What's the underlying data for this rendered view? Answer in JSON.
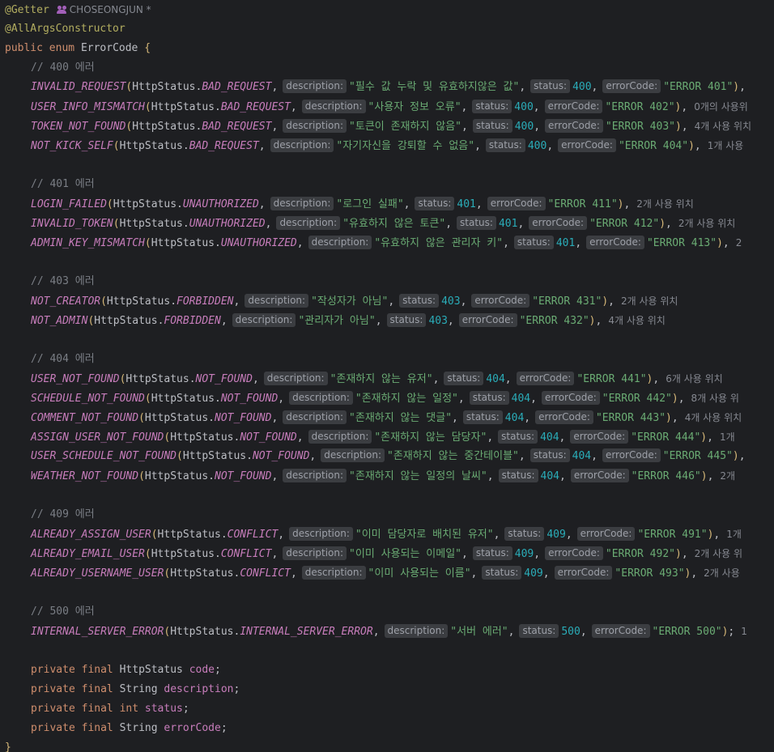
{
  "header": {
    "annotation_getter": "@Getter",
    "author": "CHOSEONGJUN *",
    "annotation_constructor": "@AllArgsConstructor",
    "kw_public": "public",
    "kw_enum": "enum",
    "class_name": "ErrorCode",
    "open_brace": "{"
  },
  "hints": {
    "description": "description:",
    "status": "status:",
    "errorCode": "errorCode:"
  },
  "groups": [
    {
      "comment": "// 400 에러",
      "entries": [
        {
          "name": "INVALID_REQUEST",
          "status_enum": "BAD_REQUEST",
          "description": "\"필수 값 누락 및 유효하지않은 값\"",
          "status": "400",
          "code": "\"ERROR 401\"",
          "usage": ""
        },
        {
          "name": "USER_INFO_MISMATCH",
          "status_enum": "BAD_REQUEST",
          "description": "\"사용자 정보 오류\"",
          "status": "400",
          "code": "\"ERROR 402\"",
          "usage": "0개의 사용위"
        },
        {
          "name": "TOKEN_NOT_FOUND",
          "status_enum": "BAD_REQUEST",
          "description": "\"토큰이 존재하지 않음\"",
          "status": "400",
          "code": "\"ERROR 403\"",
          "usage": "4개 사용 위치"
        },
        {
          "name": "NOT_KICK_SELF",
          "status_enum": "BAD_REQUEST",
          "description": "\"자기자신을 강퇴할 수 없음\"",
          "status": "400",
          "code": "\"ERROR 404\"",
          "usage": "1개 사용"
        }
      ]
    },
    {
      "comment": "// 401 에러",
      "entries": [
        {
          "name": "LOGIN_FAILED",
          "status_enum": "UNAUTHORIZED",
          "description": "\"로그인 실패\"",
          "status": "401",
          "code": "\"ERROR 411\"",
          "usage": "2개 사용 위치"
        },
        {
          "name": "INVALID_TOKEN",
          "status_enum": "UNAUTHORIZED",
          "description": "\"유효하지 않은 토큰\"",
          "status": "401",
          "code": "\"ERROR 412\"",
          "usage": "2개 사용 위치"
        },
        {
          "name": "ADMIN_KEY_MISMATCH",
          "status_enum": "UNAUTHORIZED",
          "description": "\"유효하지 않은 관리자 키\"",
          "status": "401",
          "code": "\"ERROR 413\"",
          "usage": "2"
        }
      ]
    },
    {
      "comment": "// 403 에러",
      "entries": [
        {
          "name": "NOT_CREATOR",
          "status_enum": "FORBIDDEN",
          "description": "\"작성자가 아님\"",
          "status": "403",
          "code": "\"ERROR 431\"",
          "usage": "2개 사용 위치"
        },
        {
          "name": "NOT_ADMIN",
          "status_enum": "FORBIDDEN",
          "description": "\"관리자가 아님\"",
          "status": "403",
          "code": "\"ERROR 432\"",
          "usage": "4개 사용 위치"
        }
      ]
    },
    {
      "comment": "// 404 에러",
      "entries": [
        {
          "name": "USER_NOT_FOUND",
          "status_enum": "NOT_FOUND",
          "description": "\"존재하지 않는 유저\"",
          "status": "404",
          "code": "\"ERROR 441\"",
          "usage": "6개 사용 위치"
        },
        {
          "name": "SCHEDULE_NOT_FOUND",
          "status_enum": "NOT_FOUND",
          "description": "\"존재하지 않는 일정\"",
          "status": "404",
          "code": "\"ERROR 442\"",
          "usage": "8개 사용 위"
        },
        {
          "name": "COMMENT_NOT_FOUND",
          "status_enum": "NOT_FOUND",
          "description": "\"존재하지 않는 댓글\"",
          "status": "404",
          "code": "\"ERROR 443\"",
          "usage": "4개 사용 위치"
        },
        {
          "name": "ASSIGN_USER_NOT_FOUND",
          "status_enum": "NOT_FOUND",
          "description": "\"존재하지 않는 담당자\"",
          "status": "404",
          "code": "\"ERROR 444\"",
          "usage": "1개"
        },
        {
          "name": "USER_SCHEDULE_NOT_FOUND",
          "status_enum": "NOT_FOUND",
          "description": "\"존재하지 않는 중간테이블\"",
          "status": "404",
          "code": "\"ERROR 445\"",
          "usage": ""
        },
        {
          "name": "WEATHER_NOT_FOUND",
          "status_enum": "NOT_FOUND",
          "description": "\"존재하지 않는 일정의 날씨\"",
          "status": "404",
          "code": "\"ERROR 446\"",
          "usage": "2개"
        }
      ]
    },
    {
      "comment": "// 409 에러",
      "entries": [
        {
          "name": "ALREADY_ASSIGN_USER",
          "status_enum": "CONFLICT",
          "description": "\"이미 담당자로 배치된 유저\"",
          "status": "409",
          "code": "\"ERROR 491\"",
          "usage": "1개"
        },
        {
          "name": "ALREADY_EMAIL_USER",
          "status_enum": "CONFLICT",
          "description": "\"이미 사용되는 이메일\"",
          "status": "409",
          "code": "\"ERROR 492\"",
          "usage": "2개 사용 위"
        },
        {
          "name": "ALREADY_USERNAME_USER",
          "status_enum": "CONFLICT",
          "description": "\"이미 사용되는 이름\"",
          "status": "409",
          "code": "\"ERROR 493\"",
          "usage": "2개 사용"
        }
      ]
    },
    {
      "comment": "// 500 에러",
      "entries": [
        {
          "name": "INTERNAL_SERVER_ERROR",
          "status_enum": "INTERNAL_SERVER_ERROR",
          "description": "\"서버 에러\"",
          "status": "500",
          "code": "\"ERROR 500\"",
          "usage": "1",
          "last": true
        }
      ]
    }
  ],
  "fields": [
    {
      "kw1": "private",
      "kw2": "final",
      "type": "HttpStatus",
      "name": "code"
    },
    {
      "kw1": "private",
      "kw2": "final",
      "type": "String",
      "name": "description"
    },
    {
      "kw1": "private",
      "kw2": "final",
      "type": "int",
      "name": "status",
      "primitive": true
    },
    {
      "kw1": "private",
      "kw2": "final",
      "type": "String",
      "name": "errorCode"
    }
  ],
  "footer": {
    "close_brace": "}"
  },
  "colors": {
    "background": "#1e1f22",
    "keyword": "#cf8e6d",
    "string": "#6aab73",
    "number": "#2aacb8",
    "enum_constant": "#c77dbb",
    "annotation": "#b3ae60",
    "comment": "#7a7e85"
  }
}
